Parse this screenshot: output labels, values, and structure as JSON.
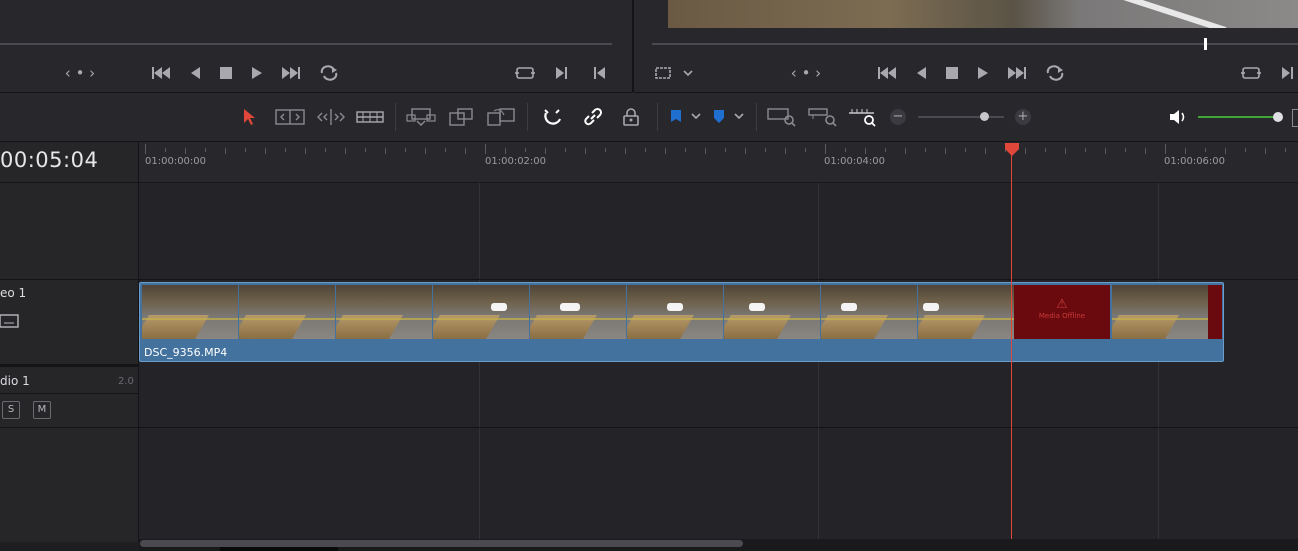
{
  "source_viewer": {
    "nav_dots": "‹ • ›"
  },
  "program_viewer": {
    "nav_dots": "‹ • ›"
  },
  "timeline": {
    "current_timecode": "00:05:04",
    "ruler_labels": [
      "01:00:00:00",
      "01:00:02:00",
      "01:00:04:00",
      "01:00:06:00"
    ],
    "zoom_minus": "−",
    "zoom_plus": "+"
  },
  "tracks": {
    "video1": {
      "label": "eo 1"
    },
    "audio1": {
      "label": "dio 1",
      "channels": "2.0",
      "solo": "S",
      "mute": "M"
    }
  },
  "clip": {
    "name": "DSC_9356.MP4",
    "offline_text": "Media Offline",
    "offline_icon": "⚠"
  },
  "colors": {
    "accent_playhead": "#e0473a",
    "clip_blue": "#43729e",
    "volume_green": "#3fa536",
    "flag_blue": "#1f6fd1"
  }
}
